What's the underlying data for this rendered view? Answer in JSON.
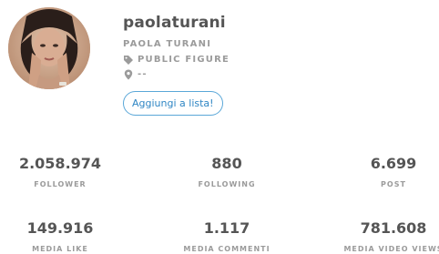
{
  "profile": {
    "username": "paolaturani",
    "full_name": "PAOLA TURANI",
    "category": "PUBLIC FIGURE",
    "category_icon": "tag-icon",
    "location": "--",
    "location_icon": "map-pin-icon",
    "add_to_list_label": "Aggiungi a lista!"
  },
  "stats_row1": [
    {
      "value": "2.058.974",
      "label": "FOLLOWER"
    },
    {
      "value": "880",
      "label": "FOLLOWING"
    },
    {
      "value": "6.699",
      "label": "POST"
    }
  ],
  "stats_row2": [
    {
      "value": "149.916",
      "label": "MEDIA LIKE"
    },
    {
      "value": "1.117",
      "label": "MEDIA COMMENTI"
    },
    {
      "value": "781.608",
      "label": "MEDIA VIDEO VIEWS"
    }
  ],
  "colors": {
    "accent": "#2f86c4",
    "accent_border": "#5aa7d8",
    "text_dark": "#555555",
    "text_muted": "#9b9b9b"
  }
}
